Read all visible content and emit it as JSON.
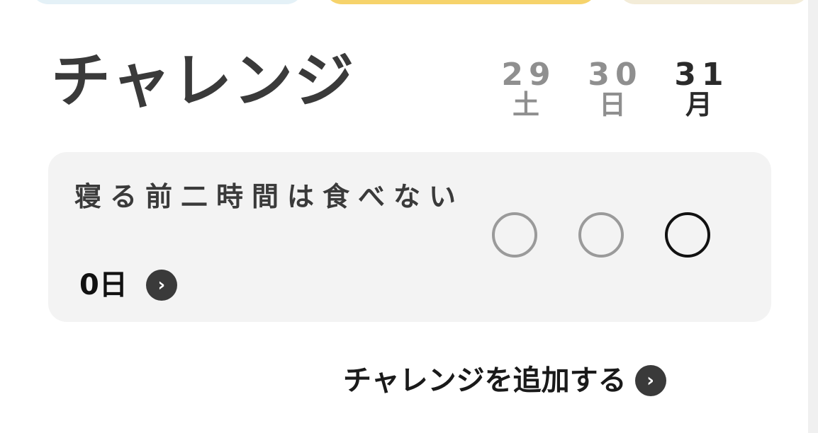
{
  "section": {
    "title": "チャレンジ"
  },
  "days": [
    {
      "num": "29",
      "weekday": "土",
      "state": "past"
    },
    {
      "num": "30",
      "weekday": "日",
      "state": "past"
    },
    {
      "num": "31",
      "weekday": "月",
      "state": "today"
    }
  ],
  "challenge": {
    "title": "寝る前二時間は食べない",
    "streak": "0日",
    "chevron_icon": "›"
  },
  "add": {
    "label": "チャレンジを追加する",
    "chevron_icon": "›"
  },
  "colors": {
    "card_bg": "#f3f3f3",
    "past": "#8f8f8f",
    "today": "#2a2a2a",
    "yellow_card": "#f6d36b"
  }
}
